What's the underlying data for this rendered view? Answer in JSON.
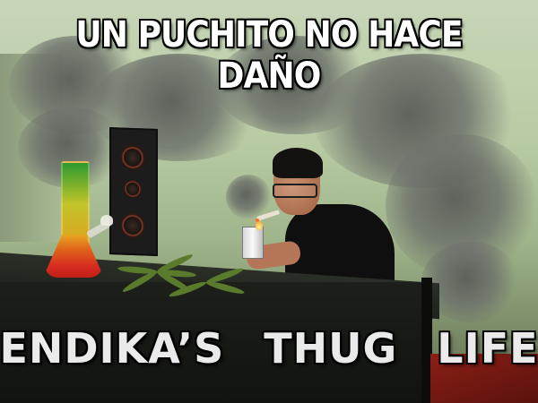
{
  "meme": {
    "top_text": "UN PUCHITO NO HACE DAÑO",
    "bottom_text": {
      "word1": "ENDIKA’S",
      "word2": "THUG",
      "word3": "LIFE"
    }
  },
  "colors": {
    "background": "#b8cba4",
    "table": "#1c1f1a",
    "smoke": "#6e736c",
    "caption_fill": "#ffffff",
    "caption_outline": "#000000",
    "bong_green": "#2e9a2e",
    "bong_yellow": "#c2c42a",
    "bong_red": "#d62a1f"
  },
  "icons": [
    "bong-icon",
    "lighter-icon",
    "cannabis-leaf-icon",
    "speaker-icon"
  ]
}
